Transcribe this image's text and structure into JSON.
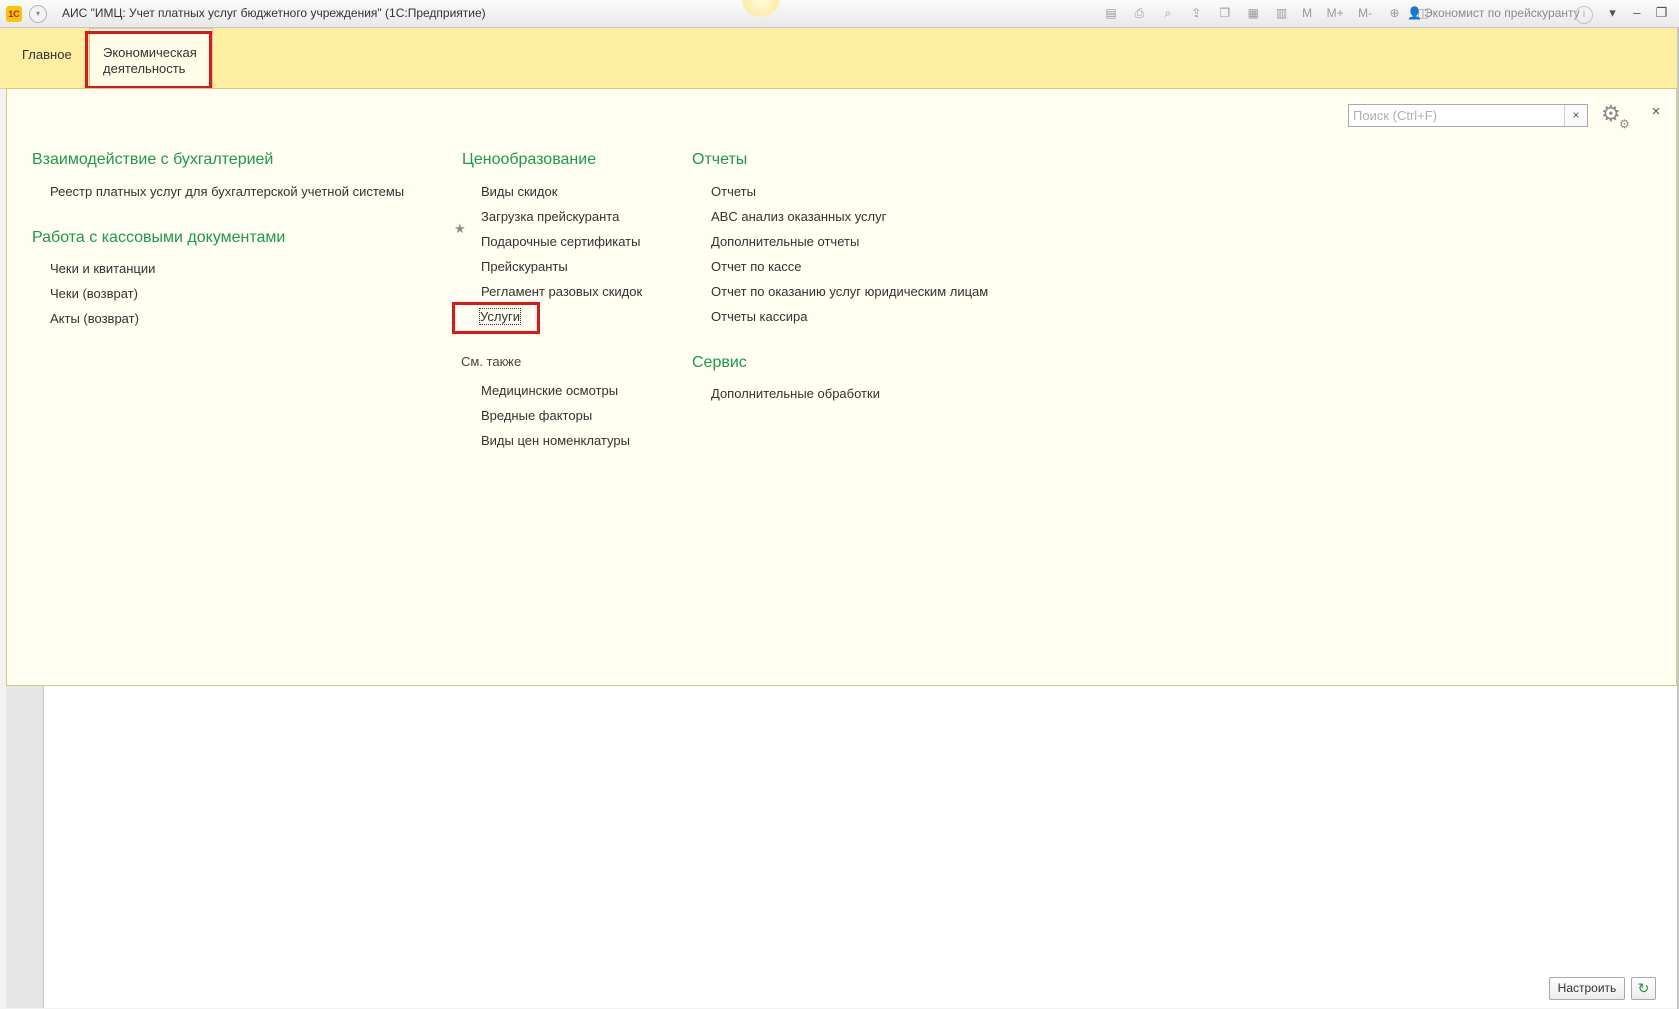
{
  "titlebar": {
    "app_logo": "1С",
    "title": "АИС \"ИМЦ: Учет платных услуг бюджетного учреждения\"  (1С:Предприятие)",
    "toolbar_text_buttons": [
      "M",
      "M+",
      "M-"
    ],
    "user": "Экономист по прейскуранту"
  },
  "sections": {
    "tabs": [
      {
        "label": "Главное"
      },
      {
        "label": "Экономическая деятельность",
        "line1": "Экономическая",
        "line2": "деятельность"
      }
    ]
  },
  "search": {
    "placeholder": "Поиск (Ctrl+F)",
    "value": "",
    "clear_symbol": "×"
  },
  "panel": {
    "close_symbol": "×",
    "col1": {
      "groups": [
        {
          "title": "Взаимодействие с бухгалтерией",
          "items": [
            "Реестр платных услуг для бухгалтерской учетной системы"
          ]
        },
        {
          "title": "Работа с кассовыми документами",
          "items": [
            "Чеки и квитанции",
            "Чеки (возврат)",
            "Акты (возврат)"
          ]
        }
      ]
    },
    "col2": {
      "groups": [
        {
          "title": "Ценообразование",
          "items": [
            "Виды скидок",
            "Загрузка прейскуранта",
            "Подарочные сертификаты",
            "Прейскуранты",
            "Регламент разовых скидок",
            "Услуги"
          ]
        }
      ],
      "see_also": {
        "title": "См. также",
        "items": [
          "Медицинские осмотры",
          "Вредные факторы",
          "Виды цен номенклатуры"
        ]
      }
    },
    "col3": {
      "groups": [
        {
          "title": "Отчеты",
          "items": [
            "Отчеты",
            "ABC анализ оказанных услуг",
            "Дополнительные отчеты",
            "Отчет по кассе",
            "Отчет по оказанию услуг юридическим лицам",
            "Отчеты кассира"
          ]
        },
        {
          "title": "Сервис",
          "items": [
            "Дополнительные обработки"
          ]
        }
      ]
    }
  },
  "footer": {
    "customize_label": "Настроить"
  },
  "colors": {
    "section_bar": "#fdeea2",
    "panel_bg": "#fffef1",
    "group_title": "#1c9b4c",
    "highlight_frame": "#e0151a"
  }
}
